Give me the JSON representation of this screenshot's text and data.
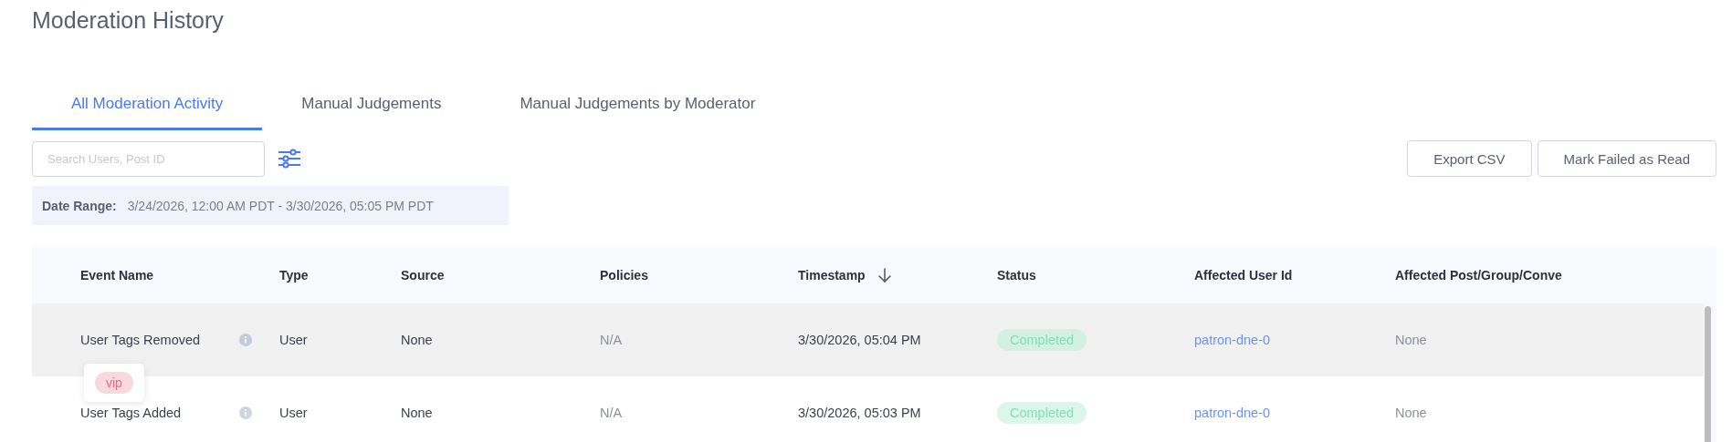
{
  "page": {
    "title": "Moderation History"
  },
  "tabs": [
    {
      "label": "All Moderation Activity",
      "selected": true
    },
    {
      "label": "Manual Judgements",
      "selected": false
    },
    {
      "label": "Manual Judgements by Moderator",
      "selected": false
    }
  ],
  "search": {
    "placeholder": "Search Users, Post ID"
  },
  "date_range": {
    "label": "Date Range:",
    "value": "3/24/2026, 12:00 AM PDT - 3/30/2026, 05:05 PM PDT"
  },
  "buttons": [
    "Export CSV",
    "Mark Failed as Read"
  ],
  "table": {
    "columns": [
      {
        "label": "Event Name",
        "sorted": false
      },
      {
        "label": "Type",
        "sorted": false
      },
      {
        "label": "Source",
        "sorted": false
      },
      {
        "label": "Policies",
        "sorted": false
      },
      {
        "label": "Timestamp",
        "sorted": true
      },
      {
        "label": "Status",
        "sorted": false
      },
      {
        "label": "Affected User Id",
        "sorted": false
      },
      {
        "label": "Affected Post/Group/Conve",
        "sorted": false
      }
    ],
    "rows": [
      {
        "event_name": "User Tags Removed",
        "type": "User",
        "source": "None",
        "policies": "N/A",
        "timestamp": "3/30/2026, 05:04 PM",
        "status": "Completed",
        "affected_user_id": "patron-dne-0",
        "affected_post": "None",
        "highlighted": true,
        "tooltip_tags": [
          "vip"
        ]
      },
      {
        "event_name": "User Tags Added",
        "type": "User",
        "source": "None",
        "policies": "N/A",
        "timestamp": "3/30/2026, 05:03 PM",
        "status": "Completed",
        "affected_user_id": "patron-dne-0",
        "affected_post": "None",
        "highlighted": false
      }
    ]
  }
}
